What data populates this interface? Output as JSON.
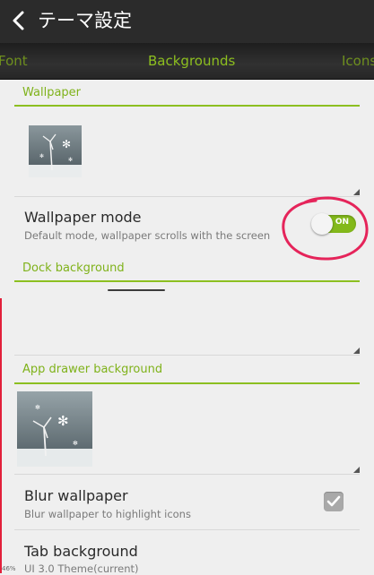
{
  "header": {
    "title": "テーマ設定",
    "back_icon": "back-chevron-icon"
  },
  "tabs": [
    {
      "label": "Font",
      "active": false
    },
    {
      "label": "Backgrounds",
      "active": true
    },
    {
      "label": "Icons",
      "active": false
    }
  ],
  "wallpaper": {
    "section_title": "Wallpaper"
  },
  "wallpaper_mode": {
    "title": "Wallpaper mode",
    "subtitle": "Default mode, wallpaper scrolls with the screen",
    "toggle_label": "ON",
    "toggle_on": true
  },
  "dock": {
    "section_title": "Dock background"
  },
  "app_drawer": {
    "section_title": "App drawer background"
  },
  "blur": {
    "title": "Blur wallpaper",
    "subtitle": "Blur wallpaper to highlight icons",
    "checked": true
  },
  "tab_background": {
    "title": "Tab background",
    "subtitle": "UI 3.0 Theme(current)"
  },
  "status": {
    "battery": "46%"
  },
  "colors": {
    "accent": "#8cbf20",
    "annotation": "#e5245a",
    "appbar": "#2b2b2b"
  }
}
